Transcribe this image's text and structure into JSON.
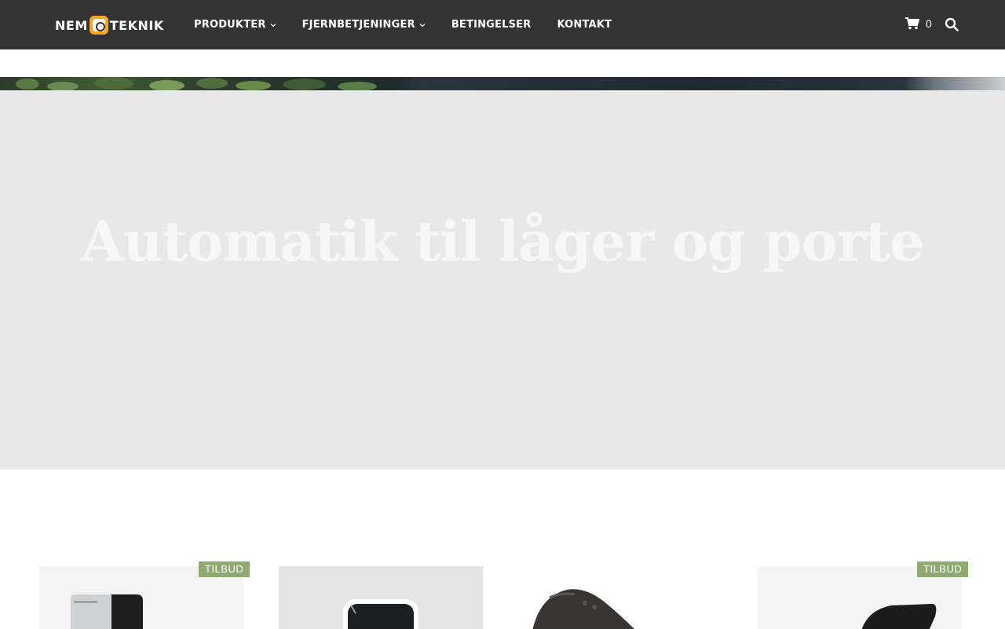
{
  "header": {
    "logo": {
      "left": "NEM",
      "right": "TEKNIK"
    },
    "nav": [
      {
        "label": "PRODUKTER",
        "dropdown": true
      },
      {
        "label": "FJERNBETJENINGER",
        "dropdown": true
      },
      {
        "label": "BETINGELSER",
        "dropdown": false
      },
      {
        "label": "KONTAKT",
        "dropdown": false
      }
    ],
    "cart_count": "0",
    "icons": {
      "cart": "shopping-cart-icon",
      "search": "search-icon"
    }
  },
  "hero": {
    "title": "Automatik til låger og porte"
  },
  "products": {
    "badge_label": "TILBUD",
    "items": [
      {
        "badge": "TILBUD"
      },
      {
        "badge": ""
      },
      {
        "badge": ""
      },
      {
        "badge": "TILBUD"
      }
    ]
  },
  "colors": {
    "header_bg": "#333333",
    "hero_bg": "#e8e8e8",
    "badge_bg": "#8faa71",
    "logo_accent": "#f5a623"
  }
}
